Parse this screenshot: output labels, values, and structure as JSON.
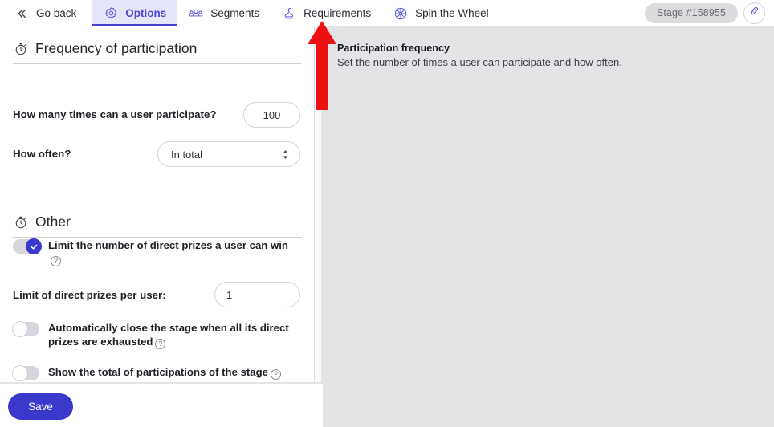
{
  "topbar": {
    "tabs": [
      {
        "label": "Go back",
        "icon": "double-chevron-left-icon",
        "active": false
      },
      {
        "label": "Options",
        "icon": "gear-icon",
        "active": true
      },
      {
        "label": "Segments",
        "icon": "users-group-icon",
        "active": false
      },
      {
        "label": "Requirements",
        "icon": "stamp-icon",
        "active": false
      },
      {
        "label": "Spin the Wheel",
        "icon": "wheel-icon",
        "active": false
      }
    ],
    "stage_badge": "Stage #158955",
    "link_icon": "link-chain-icon"
  },
  "left_panel": {
    "sections": [
      {
        "title": "Frequency of participation",
        "icon": "stopwatch-icon"
      },
      {
        "title": "Other",
        "icon": "stopwatch-icon"
      }
    ],
    "fields": {
      "participate_label": "How many times can a user participate?",
      "participate_value": "100",
      "participate_placeholder": "",
      "how_often_label": "How often?",
      "how_often_value": "In total",
      "how_often_options": [
        "In total"
      ],
      "limit_per_user_label": "Limit of direct prizes per user:",
      "limit_per_user_value": "1",
      "limit_per_user_placeholder": ""
    },
    "toggles": [
      {
        "label": "Limit the number of direct prizes a user can win",
        "state": "on",
        "help": "?"
      },
      {
        "label": "Automatically close the stage when all its direct prizes are exhausted",
        "state": "off",
        "help": "?"
      },
      {
        "label": "Show the total of participations of the stage",
        "state": "off",
        "help": "?"
      }
    ]
  },
  "footer": {
    "save_label": "Save"
  },
  "right_panel": {
    "title": "Participation frequency",
    "description": "Set the number of times a user can participate and how often."
  },
  "annotation": {
    "type": "red-arrow-up",
    "color": "#ee1111",
    "points_to": "Requirements"
  },
  "colors": {
    "accent": "#3b39cc",
    "active_tab_text": "#4e4ad4",
    "active_tab_bg": "#e6e6fa",
    "page_bg": "#e4e4e6",
    "panel_bg": "#ffffff",
    "toggle_off": "#d6d6dc"
  }
}
